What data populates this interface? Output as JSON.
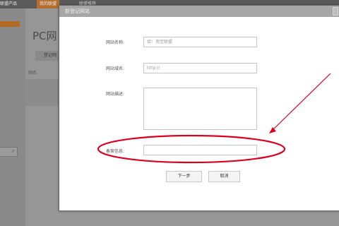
{
  "background": {
    "brand_text": "联盟产品",
    "tabs": [
      {
        "label": "我的联盟"
      },
      {
        "label": "联盟推荐"
      }
    ],
    "page_title": "PC网",
    "sub_tab": "登记网",
    "sub_text": "网名"
  },
  "dialog": {
    "title": "新登记网站",
    "fields": [
      {
        "label": "网站名称:",
        "value": "",
        "placeholder": "如：淘宝联盟"
      },
      {
        "label": "网站域名:",
        "value": "http://",
        "placeholder": ""
      },
      {
        "label": "网站描述:",
        "value": "",
        "placeholder": ""
      },
      {
        "label": "备案信息:",
        "value": "",
        "placeholder": ""
      }
    ],
    "buttons": {
      "next": "下一步",
      "cancel": "取消"
    }
  },
  "colors": {
    "annotation": "#d9001f",
    "active_tab": "#b46e2d"
  }
}
